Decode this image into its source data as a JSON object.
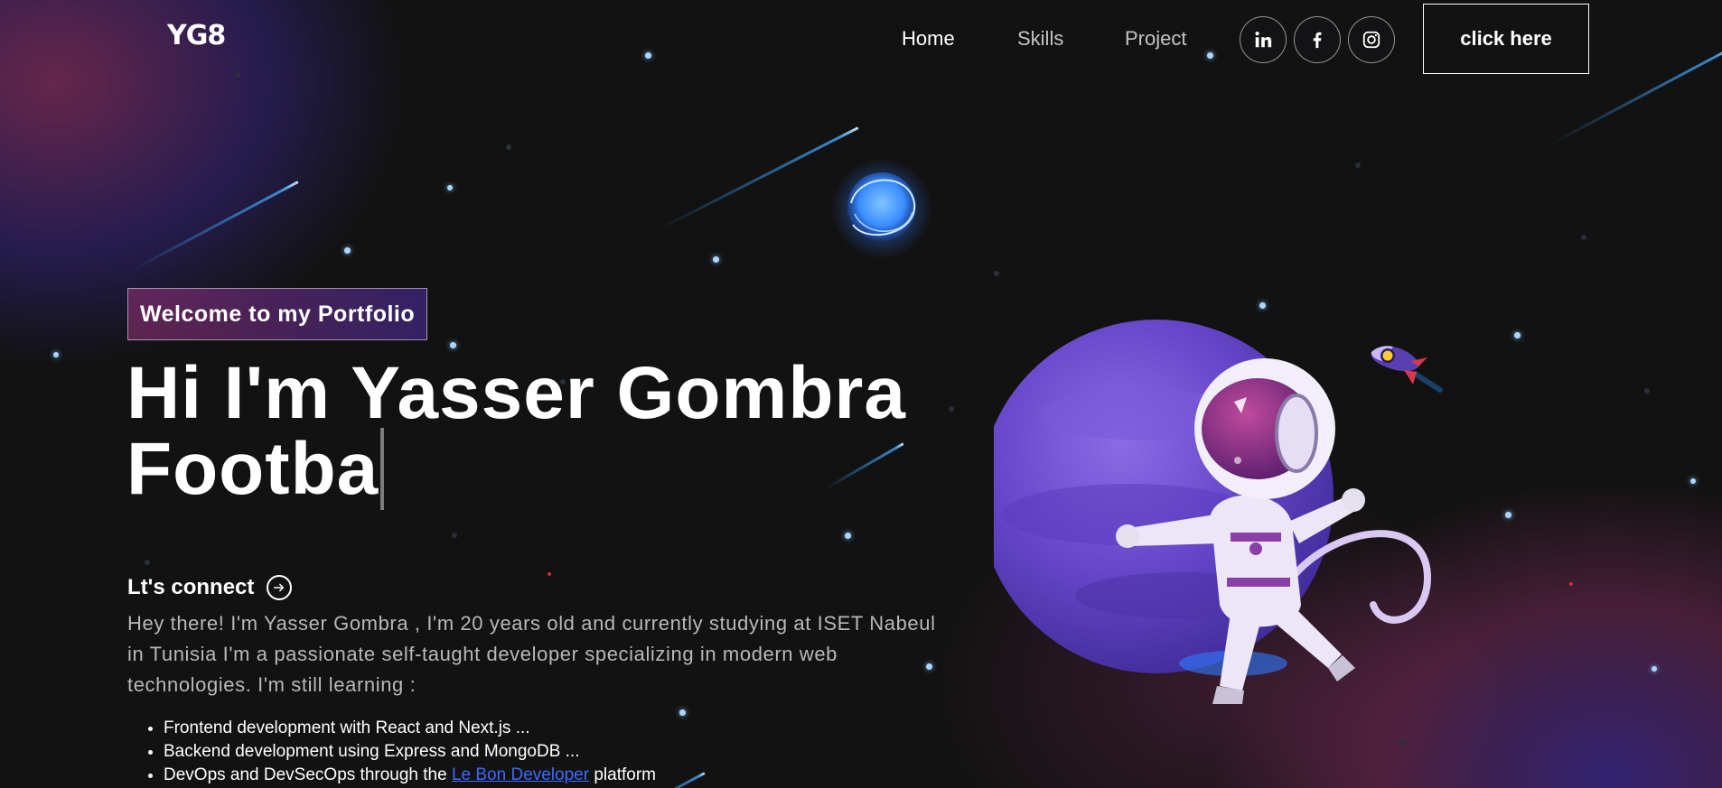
{
  "brand": {
    "logo": "YG8"
  },
  "nav": {
    "links": [
      {
        "label": "Home",
        "active": true
      },
      {
        "label": "Skills",
        "active": false
      },
      {
        "label": "Project",
        "active": false
      }
    ],
    "social": [
      "linkedin-icon",
      "facebook-icon",
      "instagram-icon"
    ],
    "cta_label": "click here"
  },
  "hero": {
    "tagline": "Welcome to my Portfolio",
    "title_line1": "Hi I'm Yasser Gombra",
    "title_line2": "Footba",
    "connect_label": "Lt's connect",
    "about": "Hey there! I'm Yasser Gombra , I'm 20 years old and currently studying at ISET Nabeul in Tunisia I'm a passionate self-taught developer specializing in modern web technologies. I'm still learning :",
    "skills": [
      "Frontend development with React and Next.js ...",
      "Backend development using Express and MongoDB ..."
    ],
    "skill3_prefix": "DevOps and DevSecOps through the",
    "skill3_link": "Le Bon Developer",
    "skill3_suffix": "platform"
  },
  "colors": {
    "background": "#121212",
    "accent_pink": "#aa367c",
    "accent_purple": "#4a2fbd",
    "link": "#3b6bff"
  }
}
